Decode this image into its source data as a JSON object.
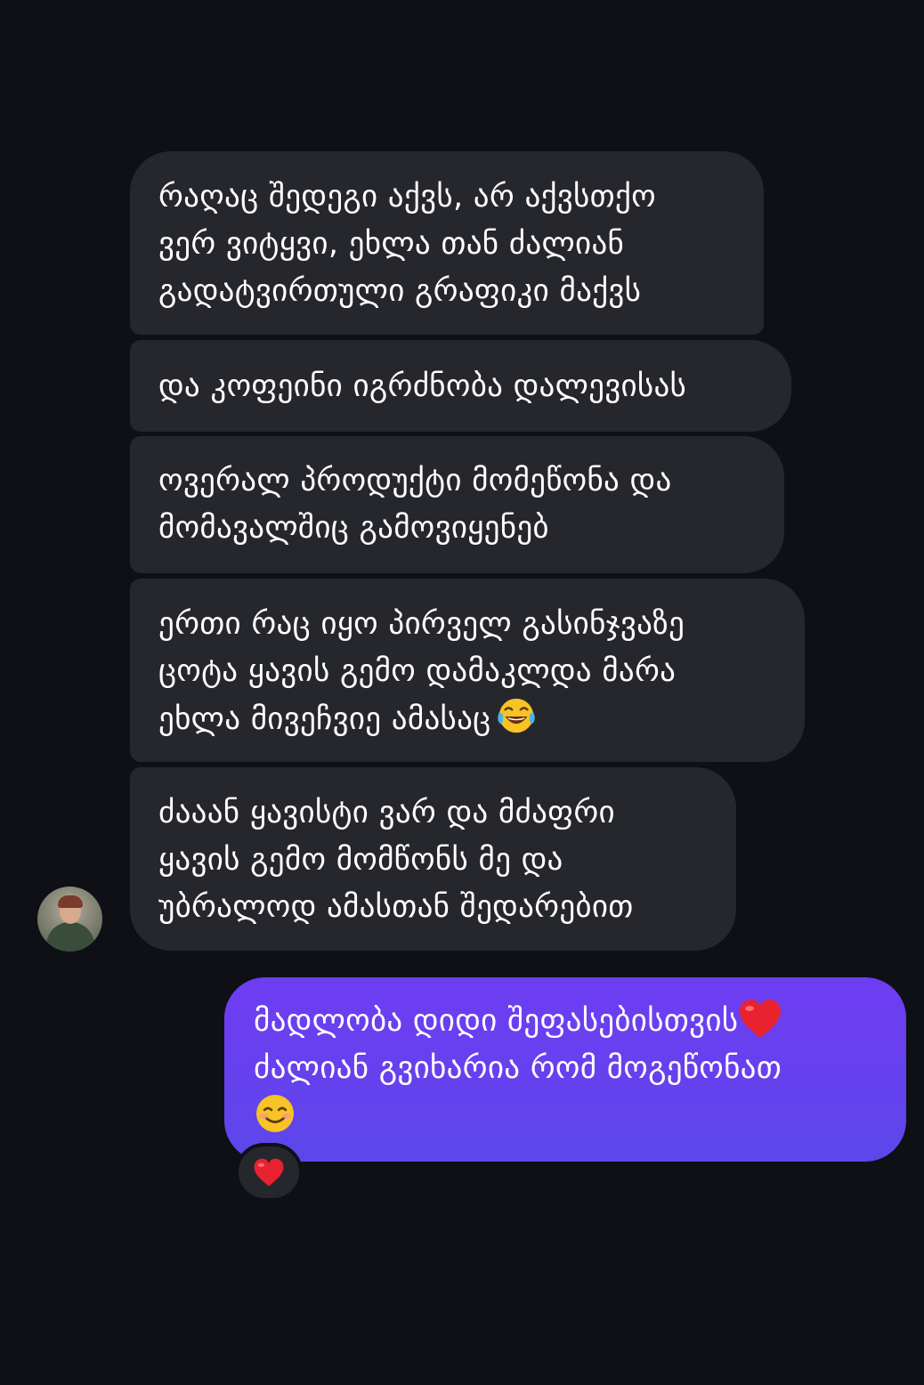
{
  "thread": {
    "incoming": [
      {
        "lines": [
          "რაღაც შედეგი აქვს, არ აქვსთქო",
          "ვერ ვიტყვი, ეხლა თან ძალიან",
          "გადატვირთული გრაფიკი მაქვს"
        ]
      },
      {
        "lines": [
          "და კოფეინი იგრძნობა დალევისას"
        ]
      },
      {
        "lines": [
          "ოვერალ პროდუქტი მომეწონა და",
          "მომავალშიც გამოვიყენებ"
        ]
      },
      {
        "lines": [
          "ერთი რაც იყო პირველ გასინჯვაზე",
          "ცოტა ყავის გემო დამაკლდა მარა",
          "ეხლა მივეჩვიე ამასაც"
        ],
        "emoji": "face-with-tears-of-joy"
      },
      {
        "lines": [
          "ძააან ყავისტი ვარ და მძაფრი",
          "ყავის გემო მომწონს მე და",
          "უბრალოდ ამასთან შედარებით"
        ]
      }
    ],
    "outgoing": {
      "lines": [
        "მადლობა დიდი შეფასებისთვის",
        "ძალიან გვიხარია რომ მოგეწონათ"
      ],
      "emojis": [
        "red-heart",
        "smiling-face"
      ]
    },
    "reaction": "red-heart"
  },
  "colors": {
    "background": "#0e1016",
    "incoming_bubble": "#26272d",
    "outgoing_bubble": "#6541ee",
    "text": "#ffffff"
  }
}
